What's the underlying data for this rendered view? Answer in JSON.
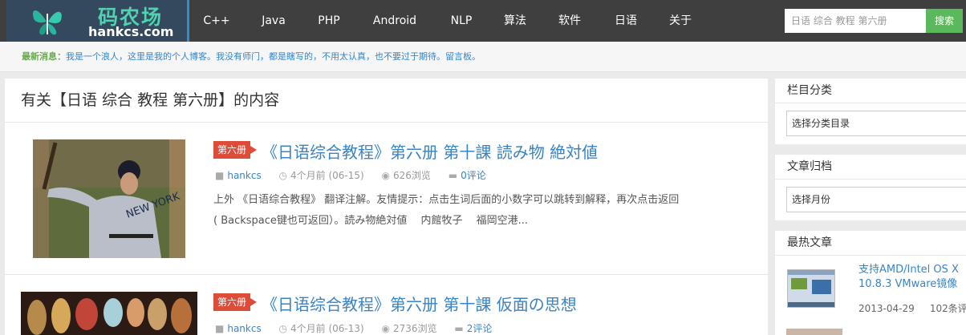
{
  "header": {
    "logo_cn": "码农场",
    "logo_en": "hankcs.com",
    "nav": [
      "C++",
      "Java",
      "PHP",
      "Android",
      "NLP",
      "算法",
      "软件",
      "日语",
      "关于"
    ],
    "search_placeholder": "日语 综合 教程 第六册",
    "search_button": "搜索"
  },
  "notice": {
    "label": "最新消息：",
    "text": "我是一个浪人，这里是我的个人博客。我没有师门，都是瞎写的，不用太认真，也不要过于期待。留言板。"
  },
  "main": {
    "page_title": "有关【日语 综合 教程 第六册】的内容",
    "posts": [
      {
        "tag": "第六册",
        "title": "《日语综合教程》第六册 第十課 読み物 絶対値",
        "author": "hankcs",
        "time": "4个月前 (06-15)",
        "views": "626浏览",
        "comments": "0评论",
        "excerpt_line1": "上外 《日语综合教程》 翻译注解。友情提示：点击生词后面的小数字可以跳转到解释，再次点击返回",
        "excerpt_line2": "( Backspace键也可返回）。読み物絶対値　 内館牧子　 福岡空港..."
      },
      {
        "tag": "第六册",
        "title": "《日语综合教程》第六册 第十課 仮面の思想",
        "author": "hankcs",
        "time": "4个月前 (06-13)",
        "views": "2736浏览",
        "comments": "2评论"
      }
    ]
  },
  "sidebar": {
    "categories_title": "栏目分类",
    "categories_select": "选择分类目录",
    "archive_title": "文章归档",
    "archive_select": "选择月份",
    "hot_title": "最热文章",
    "hot_post_title_line1": "支持AMD/Intel OS X",
    "hot_post_title_line2": "10.8.3 VMware镜像",
    "hot_post_date": "2013-04-29",
    "hot_post_comments": "102条评"
  },
  "colors": {
    "header_bg": "#3f3f3f",
    "link": "#3a84c4",
    "tag": "#dd4b39",
    "search_btn": "#5cb85c"
  }
}
